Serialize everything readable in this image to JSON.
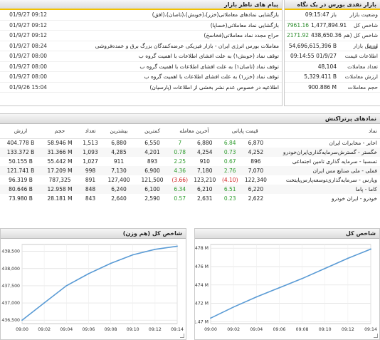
{
  "market": {
    "header": "بازار نقدی بورس در یک نگاه",
    "rows": [
      {
        "label": "وضعیت بازار",
        "value": "باز 09:15:47",
        "change": ""
      },
      {
        "label": "شاخص کل",
        "value": "1,477,894.91",
        "change": "7961.16"
      },
      {
        "label": "شاخص کل (هم وزن)",
        "value": "438,650.36",
        "change": "2171.92"
      },
      {
        "label": "ارزش بازار",
        "value": "54,696,615,396 B",
        "change": ""
      },
      {
        "label": "اطلاعات قیمت",
        "value": "09:14:55 01/9/27",
        "change": ""
      },
      {
        "label": "تعداد معاملات",
        "value": "48,104",
        "change": ""
      },
      {
        "label": "ارزش معاملات",
        "value": "5,329.411 B",
        "change": ""
      },
      {
        "label": "حجم معاملات",
        "value": "900.886 M",
        "change": ""
      }
    ]
  },
  "messages": {
    "header": "پیام های ناظر بازار",
    "rows": [
      {
        "title": "بازگشایی نمادهای معاملاتی(خزر)،(خوبش)،(تاصان)،(افق)",
        "time": "01/9/27 09:12"
      },
      {
        "title": "بازگشایی نماد معاملاتی(خساپا)",
        "time": "01/9/27 09:12"
      },
      {
        "title": "حراج مجدد نماد معاملاتی(فخاسخ)",
        "time": "01/9/27 09:12"
      },
      {
        "title": "معاملات بورس انرژی ایران - بازار فیزیکی عرضه‌کنندگان بزرگ برق و عمده‌فروشی",
        "time": "01/9/27 08:24"
      },
      {
        "title": "توقف نماد (خوبش۱) به علت افشای اطلاعات با اهمیت گروه ب",
        "time": "01/9/27 08:00"
      },
      {
        "title": "توقف نماد (تاصان۱) به علت افشای اطلاعات با اهمیت گروه ب",
        "time": "01/9/27 08:00"
      },
      {
        "title": "توقف نماد (خزر۱) به علت افشای اطلاعات با اهمیت گروه ب",
        "time": "01/9/27 08:00"
      },
      {
        "title": "اطلاعیه در خصوص عدم نشر بخشی از اطلاعات (پارسیان)",
        "time": "01/9/26 15:04"
      }
    ]
  },
  "symbols": {
    "header": "نمادهای پرتراکنش",
    "columns": {
      "name": "نماد",
      "close": "قیمت پایانی",
      "last": "آخرین معامله",
      "min": "کمترین",
      "max": "بیشترین",
      "count": "تعداد",
      "volume": "حجم",
      "value": "ارزش"
    },
    "rows": [
      {
        "name": "اخابر - مخابرات ایران",
        "close": "6,870",
        "close_chg": "6.84",
        "last": "6,880",
        "last_chg": "7",
        "min": "6,550",
        "max": "6,880",
        "count": "1,513",
        "volume": "58.946 M",
        "value": "404.778 B"
      },
      {
        "name": "خگستر - گسترش‌سرمایه‌گذاری‌ایران‌خودرو",
        "close": "4,252",
        "close_chg": "0.73",
        "last": "4,254",
        "last_chg": "0.78",
        "min": "4,201",
        "max": "4,285",
        "count": "1,093",
        "volume": "31.366 M",
        "value": "133.372 B"
      },
      {
        "name": "تسسبا - سرمایه گذاری تامین اجتماعی",
        "close": "896",
        "close_chg": "0.67",
        "last": "910",
        "last_chg": "2.25",
        "min": "893",
        "max": "911",
        "count": "1,027",
        "volume": "55.442 M",
        "value": "50.155 B"
      },
      {
        "name": "فملی - ملی صنایع مس ایران",
        "close": "7,070",
        "close_chg": "2.76",
        "last": "7,180",
        "last_chg": "4.36",
        "min": "6,900",
        "max": "7,130",
        "count": "998",
        "volume": "17.209 M",
        "value": "121.741 B"
      },
      {
        "name": "وپارس - سرمایه‌گذاری‌توسعه‌پارس‌پایتخت",
        "close": "122,340",
        "close_chg": "(4.10)",
        "last": "123,210",
        "last_chg": "(3.66)",
        "min": "121,500",
        "max": "127,400",
        "count": "891",
        "volume": "787,325",
        "value": "96.319 B"
      },
      {
        "name": "کاما - پاما",
        "close": "6,220",
        "close_chg": "6.51",
        "last": "6,210",
        "last_chg": "6.34",
        "min": "6,100",
        "max": "6,240",
        "count": "848",
        "volume": "12.958 M",
        "value": "80.646 B"
      },
      {
        "name": "خودرو - ایران خودرو",
        "close": "2,622",
        "close_chg": "0.23",
        "last": "2,631",
        "last_chg": "0.57",
        "min": "2,590",
        "max": "2,640",
        "count": "843",
        "volume": "28.181 M",
        "value": "73.980 B"
      }
    ]
  },
  "chart_data": [
    {
      "type": "line",
      "title": "شاخص کل (هم وزن)",
      "x": [
        "09:00",
        "09:02",
        "09:04",
        "09:06",
        "09:08",
        "09:10",
        "09:12",
        "09:14"
      ],
      "series": [
        {
          "values": [
            436500,
            437000,
            437500,
            437850,
            438150,
            438400,
            438560,
            438650
          ]
        }
      ],
      "yticks": [
        "436,500",
        "437,000",
        "437,500",
        "438,000",
        "438,500"
      ],
      "ylim": [
        436400,
        438700
      ],
      "grid": true,
      "color": "#5a9bd5"
    },
    {
      "type": "line",
      "title": "شاخص کل",
      "x": [
        "09:00",
        "09:02",
        "09:04",
        "09:06",
        "09:08",
        "09:10",
        "09:12",
        "09:14"
      ],
      "series": [
        {
          "values": [
            1470400,
            1471600,
            1472700,
            1473700,
            1474700,
            1475800,
            1476900,
            1477900
          ]
        }
      ],
      "yticks": [
        "1.47 M",
        "1.472 M",
        "1.474 M",
        "1.476 M",
        "1.478 M"
      ],
      "ylim": [
        1469800,
        1478400
      ],
      "grid": true,
      "color": "#5a9bd5"
    }
  ]
}
